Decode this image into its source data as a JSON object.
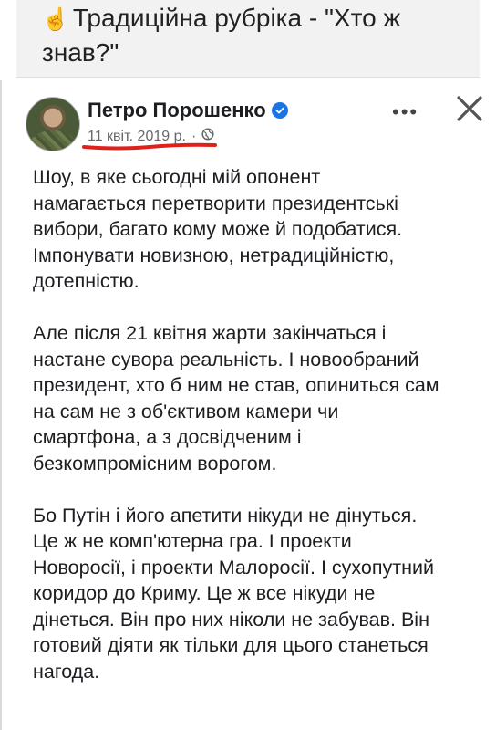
{
  "caption": {
    "icon": "pointing-up-hand-icon",
    "text": "Традиційна рубріка - \"Хто ж знав?\""
  },
  "post": {
    "author": "Петро Порошенко",
    "date": "11 квіт. 2019 р.",
    "separator": "·",
    "audience_icon": "globe-icon",
    "more_icon": "more-horizontal-icon",
    "close_icon": "close-icon",
    "accent_color": "#1b74e4",
    "highlight_color": "#e0201b",
    "paragraphs": [
      "Шоу, в яке сьогодні мій опонент\nнамагається перетворити президентські\nвибори, багато кому може й подобатися.\nІмпонувати новизною, нетрадиційністю,\nдотепністю.",
      "Але після 21 квітня жарти закінчаться і\nнастане сувора реальність. І новообраний\nпрезидент, хто б ним не став, опиниться сам\nна сам не з об'єктивом камери чи\nсмартфона, а з досвідченим і\nбезкомпромісним ворогом.",
      "Бо Путін і його апетити нікуди не дінуться.\nЦе ж не комп'ютерна гра. І проекти\nНоворосії, і проекти Малоросії. І сухопутний\nкоридор до Криму. Це ж все нікуди не\nдінеться. Він про них ніколи не забував. Він\nготовий діяти як тільки для цього станеться\nнагода."
    ]
  }
}
